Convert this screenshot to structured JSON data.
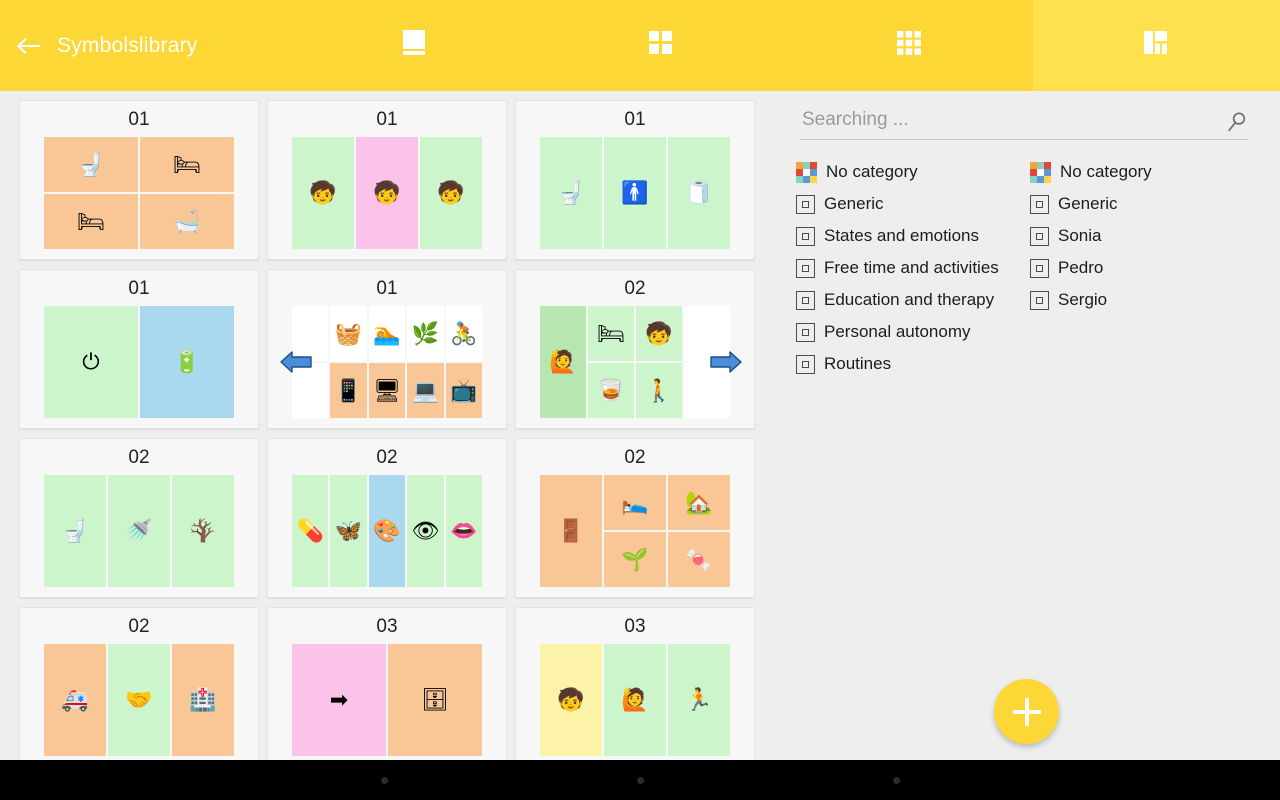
{
  "appbar": {
    "title": "Symbolslibrary",
    "back_icon": "arrow-left-icon",
    "tabs": [
      {
        "id": "tab-single",
        "icon": "book-page-icon",
        "active": false
      },
      {
        "id": "tab-grid-2x2",
        "icon": "grid-2x2-icon",
        "active": false
      },
      {
        "id": "tab-grid-3x3",
        "icon": "grid-3x3-icon",
        "active": false
      },
      {
        "id": "tab-layout-mixed",
        "icon": "layout-mixed-icon",
        "active": true
      }
    ],
    "bg_color": "#fcd736",
    "active_tab_color": "#ffe14d"
  },
  "search": {
    "placeholder": "Searching ...",
    "value": "",
    "icon": "search-icon"
  },
  "categories": {
    "left": [
      {
        "label": "No category",
        "type": "mosaic"
      },
      {
        "label": "Generic",
        "type": "checkbox",
        "checked": false
      },
      {
        "label": "States and emotions",
        "type": "checkbox",
        "checked": false
      },
      {
        "label": "Free time and activities",
        "type": "checkbox",
        "checked": false
      },
      {
        "label": "Education and therapy",
        "type": "checkbox",
        "checked": false
      },
      {
        "label": "Personal autonomy",
        "type": "checkbox",
        "checked": false
      },
      {
        "label": "Routines",
        "type": "checkbox",
        "checked": false
      }
    ],
    "right": [
      {
        "label": "No category",
        "type": "mosaic"
      },
      {
        "label": "Generic",
        "type": "checkbox",
        "checked": false
      },
      {
        "label": "Sonia",
        "type": "checkbox",
        "checked": false
      },
      {
        "label": "Pedro",
        "type": "checkbox",
        "checked": false
      },
      {
        "label": "Sergio",
        "type": "checkbox",
        "checked": false
      }
    ]
  },
  "fab": {
    "label": "+",
    "name": "add-board-button",
    "color": "#fcd736"
  },
  "palette": {
    "green": "#ccf5cc",
    "green_dark": "#b8e6b0",
    "orange": "#f8c795",
    "pink": "#fbc3ea",
    "blue": "#a9d8ef",
    "yellow": "#fdf3a8",
    "white": "#ffffff"
  },
  "boards": [
    {
      "title": "01",
      "cols": 2,
      "rows": 2,
      "cells": [
        {
          "bg": "#f8c795",
          "glyph": "🚽"
        },
        {
          "bg": "#f8c795",
          "glyph": "🛏"
        },
        {
          "bg": "#f8c795",
          "glyph": "🛏"
        },
        {
          "bg": "#f8c795",
          "glyph": "🛁"
        }
      ]
    },
    {
      "title": "01",
      "cols": 3,
      "rows": 1,
      "cells": [
        {
          "bg": "#ccf5cc",
          "glyph": "🧒"
        },
        {
          "bg": "#fbc3ea",
          "glyph": "🧒"
        },
        {
          "bg": "#ccf5cc",
          "glyph": "🧒"
        }
      ]
    },
    {
      "title": "01",
      "cols": 3,
      "rows": 1,
      "cells": [
        {
          "bg": "#ccf5cc",
          "glyph": "🚽"
        },
        {
          "bg": "#ccf5cc",
          "glyph": "🚹"
        },
        {
          "bg": "#ccf5cc",
          "glyph": "🧻"
        }
      ]
    },
    {
      "title": "01",
      "cols": 2,
      "rows": 1,
      "cells": [
        {
          "bg": "#ccf5cc",
          "glyph": "⏻"
        },
        {
          "bg": "#a9d8ef",
          "glyph": "🔋"
        }
      ]
    },
    {
      "title": "01",
      "cols": 5,
      "rows": 2,
      "pager": "left",
      "cells": [
        {
          "bg": "#ffffff",
          "glyph": ""
        },
        {
          "bg": "#ffffff",
          "glyph": "🧺"
        },
        {
          "bg": "#ffffff",
          "glyph": "🏊"
        },
        {
          "bg": "#ffffff",
          "glyph": "🌿"
        },
        {
          "bg": "#ffffff",
          "glyph": "🚴"
        },
        {
          "bg": "#ffffff",
          "glyph": ""
        },
        {
          "bg": "#f8c795",
          "glyph": "📱"
        },
        {
          "bg": "#f8c795",
          "glyph": "🖥"
        },
        {
          "bg": "#f8c795",
          "glyph": "💻"
        },
        {
          "bg": "#f8c795",
          "glyph": "📺"
        }
      ]
    },
    {
      "title": "02",
      "cols": 4,
      "rows": 2,
      "pager": "right",
      "cells": [
        {
          "bg": "#b8e6b0",
          "glyph": "🙋",
          "span2": true
        },
        {
          "bg": "#ccf5cc",
          "glyph": "🛏"
        },
        {
          "bg": "#ccf5cc",
          "glyph": "🧒"
        },
        {
          "bg": "#ffffff",
          "glyph": "",
          "span2": true
        },
        {
          "bg": "#ccf5cc",
          "glyph": "🥃"
        },
        {
          "bg": "#ccf5cc",
          "glyph": "🚶"
        }
      ]
    },
    {
      "title": "02",
      "cols": 3,
      "rows": 1,
      "cells": [
        {
          "bg": "#ccf5cc",
          "glyph": "🚽"
        },
        {
          "bg": "#ccf5cc",
          "glyph": "🚿"
        },
        {
          "bg": "#ccf5cc",
          "glyph": "🪾"
        }
      ]
    },
    {
      "title": "02",
      "cols": 5,
      "rows": 1,
      "cells": [
        {
          "bg": "#ccf5cc",
          "glyph": "💊"
        },
        {
          "bg": "#ccf5cc",
          "glyph": "🦋"
        },
        {
          "bg": "#a9d8ef",
          "glyph": "🎨"
        },
        {
          "bg": "#ccf5cc",
          "glyph": "👁"
        },
        {
          "bg": "#ccf5cc",
          "glyph": "👄"
        }
      ]
    },
    {
      "title": "02",
      "cols": 3,
      "rows": 2,
      "cells": [
        {
          "bg": "#f8c795",
          "glyph": "🚪",
          "span2": true
        },
        {
          "bg": "#f8c795",
          "glyph": "🛌"
        },
        {
          "bg": "#f8c795",
          "glyph": "🏡"
        },
        {
          "bg": "#f8c795",
          "glyph": "🌱"
        },
        {
          "bg": "#f8c795",
          "glyph": "🍬"
        }
      ]
    },
    {
      "title": "02",
      "cols": 3,
      "rows": 1,
      "cells": [
        {
          "bg": "#f8c795",
          "glyph": "🚑"
        },
        {
          "bg": "#ccf5cc",
          "glyph": "🤝"
        },
        {
          "bg": "#f8c795",
          "glyph": "🏥"
        }
      ]
    },
    {
      "title": "03",
      "cols": 2,
      "rows": 1,
      "cells": [
        {
          "bg": "#fbc3ea",
          "glyph": "➡"
        },
        {
          "bg": "#f8c795",
          "glyph": "🗄"
        }
      ]
    },
    {
      "title": "03",
      "cols": 3,
      "rows": 1,
      "cells": [
        {
          "bg": "#fdf3a8",
          "glyph": "🧒"
        },
        {
          "bg": "#ccf5cc",
          "glyph": "🙋"
        },
        {
          "bg": "#ccf5cc",
          "glyph": "🏃"
        }
      ]
    }
  ],
  "navbar": {
    "dots": 3,
    "color": "#000000"
  }
}
